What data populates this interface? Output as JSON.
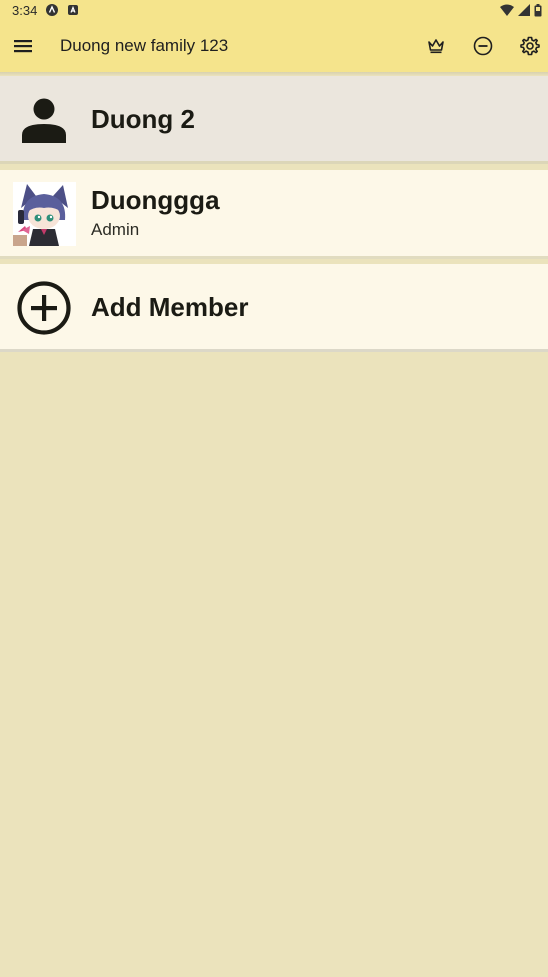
{
  "status_bar": {
    "time": "3:34",
    "icons": [
      "app-a-icon",
      "app-square-a-icon",
      "wifi-icon",
      "signal-icon",
      "battery-icon"
    ]
  },
  "app_bar": {
    "menu_icon": "menu-icon",
    "title": "Duong new family 123",
    "actions": [
      "crown-icon",
      "remove-circle-icon",
      "gear-icon"
    ]
  },
  "group": {
    "name": "Duong 2",
    "icon": "person-icon"
  },
  "members": [
    {
      "name": "Duonggga",
      "role": "Admin",
      "avatar": "anime-avatar"
    }
  ],
  "add_member": {
    "label": "Add Member",
    "icon": "add-circle-icon"
  },
  "colors": {
    "app_bar": "#f5e48c",
    "background": "#ebe3bc",
    "group_row": "#ebe6dd",
    "member_row": "#fdf8e8",
    "text": "#1c1b12"
  }
}
